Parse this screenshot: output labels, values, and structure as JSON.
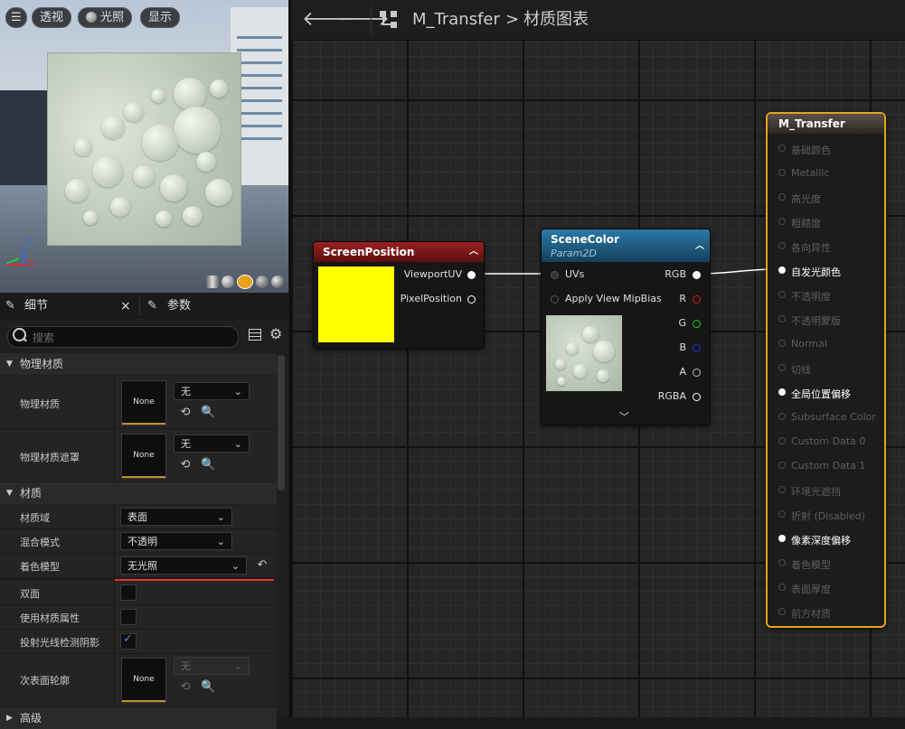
{
  "viewport": {
    "buttons": {
      "menu_icon": "hamburger-icon",
      "perspective": "透视",
      "lit": "光照",
      "show": "显示"
    },
    "axes": {
      "z": "Z",
      "x": "X"
    }
  },
  "details": {
    "tab_details": "细节",
    "tab_close": "×",
    "tab_params": "参数",
    "search_placeholder": "搜索",
    "sections": {
      "physical_material": {
        "header": "物理材质",
        "rows": {
          "phys_mat": {
            "label": "物理材质",
            "thumb": "None",
            "value": "无"
          },
          "phys_mat_mask": {
            "label": "物理材质遮罩",
            "thumb": "None",
            "value": "无"
          }
        }
      },
      "material": {
        "header": "材质",
        "rows": {
          "domain": {
            "label": "材质域",
            "value": "表面"
          },
          "blend": {
            "label": "混合模式",
            "value": "不透明"
          },
          "shading": {
            "label": "着色模型",
            "value": "无光照"
          },
          "two_sided": {
            "label": "双面"
          },
          "use_mat_attr": {
            "label": "使用材质属性"
          },
          "ray_shadow": {
            "label": "投射光线检测阴影"
          },
          "subsurface": {
            "label": "次表面轮廓",
            "thumb": "None",
            "value": "无"
          }
        }
      },
      "advanced": {
        "header": "高级"
      }
    }
  },
  "graph": {
    "breadcrumb": {
      "asset": "M_Transfer",
      "separator": ">",
      "view": "材质图表"
    },
    "nodes": {
      "screen_position": {
        "title": "ScreenPosition",
        "color": "#8c1a1a",
        "outputs": {
          "viewport_uv": "ViewportUV",
          "pixel_position": "PixelPosition"
        },
        "preview_color": "#ffff00"
      },
      "scene_color": {
        "title": "SceneColor",
        "subtitle": "Param2D",
        "color": "#1f5f86",
        "inputs": {
          "uvs": "UVs",
          "mip_bias": "Apply View MipBias"
        },
        "outputs": {
          "rgb": "RGB",
          "r": "R",
          "g": "G",
          "b": "B",
          "a": "A",
          "rgba": "RGBA"
        }
      },
      "result": {
        "title": "M_Transfer",
        "pins": [
          {
            "label": "基础颜色",
            "active": false
          },
          {
            "label": "Metallic",
            "active": false
          },
          {
            "label": "高光度",
            "active": false
          },
          {
            "label": "粗糙度",
            "active": false
          },
          {
            "label": "各向异性",
            "active": false
          },
          {
            "label": "自发光颜色",
            "active": true
          },
          {
            "label": "不透明度",
            "active": false
          },
          {
            "label": "不透明蒙版",
            "active": false
          },
          {
            "label": "Normal",
            "active": false
          },
          {
            "label": "切线",
            "active": false
          },
          {
            "label": "全局位置偏移",
            "active": true
          },
          {
            "label": "Subsurface Color",
            "active": false
          },
          {
            "label": "Custom Data 0",
            "active": false
          },
          {
            "label": "Custom Data 1",
            "active": false
          },
          {
            "label": "环境光遮挡",
            "active": false
          },
          {
            "label": "折射 (Disabled)",
            "active": false
          },
          {
            "label": "像素深度偏移",
            "active": true
          },
          {
            "label": "着色模型",
            "active": false
          },
          {
            "label": "表面厚度",
            "active": false
          },
          {
            "label": "前方材质",
            "active": false
          }
        ]
      }
    }
  },
  "colors": {
    "accent": "#e8a21a",
    "annotation_underline": "#e8332f",
    "check": "#3a8fe0"
  }
}
